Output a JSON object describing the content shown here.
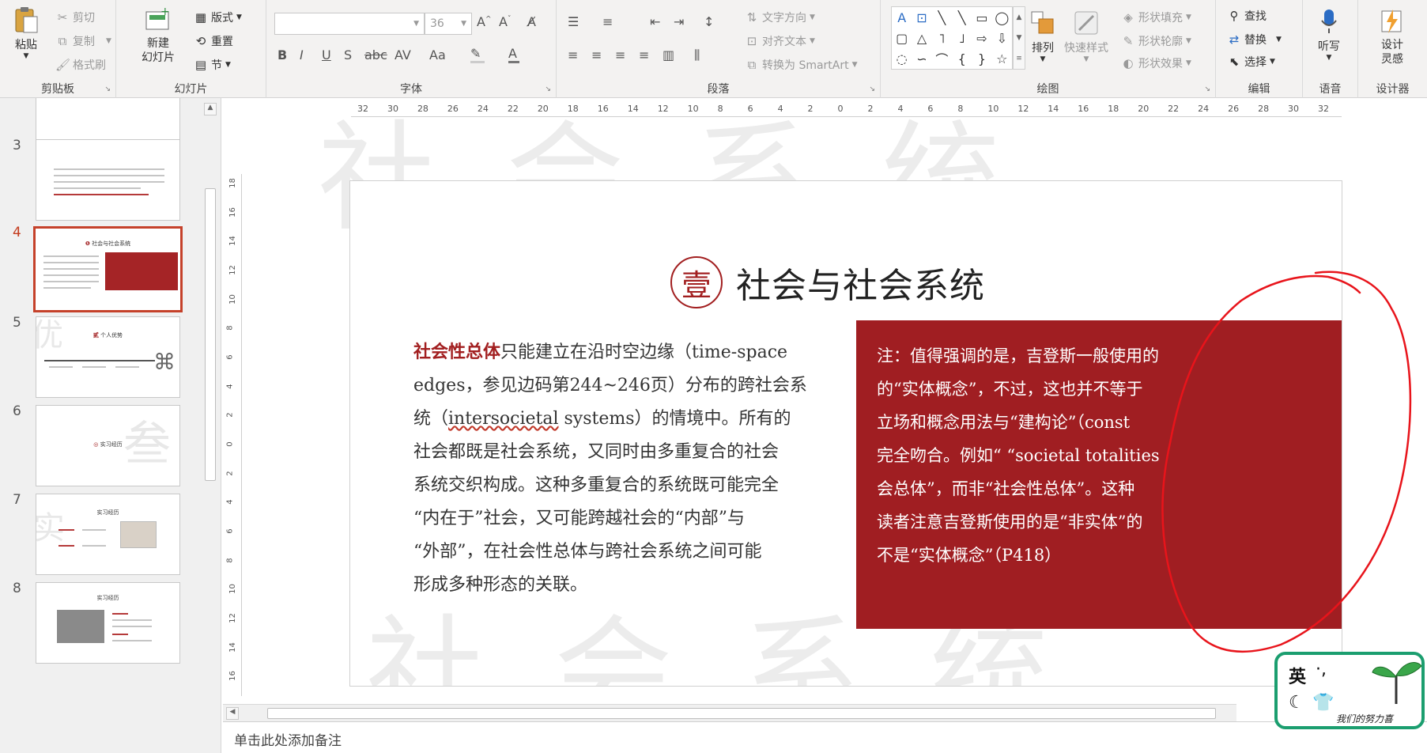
{
  "ribbon": {
    "clipboard": {
      "label": "剪贴板",
      "paste": "粘贴",
      "cut": "剪切",
      "copy": "复制",
      "format_painter": "格式刷"
    },
    "slides": {
      "label": "幻灯片",
      "new_slide": "新建\n幻灯片",
      "layout": "版式",
      "reset": "重置",
      "section": "节"
    },
    "font": {
      "label": "字体",
      "font_name": "",
      "font_size": "36",
      "bold": "B",
      "italic": "I",
      "underline": "U",
      "shadow": "S",
      "strike": "abc",
      "spacing": "AV",
      "case": "Aa"
    },
    "paragraph": {
      "label": "段落",
      "text_direction": "文字方向",
      "align_text": "对齐文本",
      "smartart": "转换为 SmartArt"
    },
    "drawing": {
      "label": "绘图",
      "arrange": "排列",
      "quick_styles": "快速样式",
      "shape_fill": "形状填充",
      "shape_outline": "形状轮廓",
      "shape_effects": "形状效果"
    },
    "editing": {
      "label": "编辑",
      "find": "查找",
      "replace": "替换",
      "select": "选择"
    },
    "voice": {
      "label": "语音",
      "dictate": "听写"
    },
    "designer": {
      "label": "设计器",
      "design_ideas": "设计\n灵感"
    }
  },
  "thumbnails": {
    "items": [
      {
        "num": "3"
      },
      {
        "num": "4"
      },
      {
        "num": "5"
      },
      {
        "num": "6"
      },
      {
        "num": "7"
      },
      {
        "num": "8"
      }
    ],
    "slide4_title": "社会与社会系统",
    "slide5_title": "个人优势",
    "slide5_badge": "贰",
    "slide6_title": "实习经历",
    "slide7_title": "实习经历",
    "slide8_title": "实习经历"
  },
  "slide": {
    "seal": "壹",
    "title": "社会与社会系统",
    "body": {
      "highlight": "社会性总体",
      "lines": [
        "只能建立在沿时空边缘（time-space",
        "edges，参见边码第244~246页）分布的跨社会系",
        "统（",
        "intersocietal",
        " systems）的情境中。所有的",
        "社会都既是社会系统，又同时由多重复合的社会",
        "系统交织构成。这种多重复合的系统既可能完全",
        "“内在于”社会，又可能跨越社会的“内部”与",
        "“外部”，在社会性总体与跨社会系统之间可能",
        "形成多种形态的关联。"
      ]
    },
    "note": {
      "lines": [
        "注：值得强调的是，吉登斯一般使用的",
        "的“实体概念”，不过，这也并不等于",
        "立场和概念用法与“建构论”（const",
        "完全吻合。例如“ “societal totalities",
        "会总体”，而非“社会性总体”。这种",
        "读者注意吉登斯使用的是“非实体”的",
        "不是“实体概念”（P418）"
      ]
    },
    "watermark_top": "社 会 系 统",
    "watermark_bottom": "社 会 系 统"
  },
  "rulers": {
    "h_labels": [
      "32",
      "30",
      "28",
      "26",
      "24",
      "22",
      "20",
      "18",
      "16",
      "14",
      "12",
      "10",
      "8",
      "6",
      "4",
      "2",
      "0",
      "2",
      "4",
      "6",
      "8",
      "10",
      "12",
      "14",
      "16",
      "18",
      "20",
      "22",
      "24",
      "26",
      "28",
      "30",
      "32"
    ],
    "v_labels": [
      "18",
      "16",
      "14",
      "12",
      "10",
      "8",
      "6",
      "4",
      "2",
      "0",
      "2",
      "4",
      "6",
      "8",
      "10",
      "12",
      "14",
      "16"
    ]
  },
  "notes": {
    "placeholder": "单击此处添加备注"
  },
  "ime": {
    "lang": "英",
    "punct": "·,",
    "slogan": "我们的努力喜"
  },
  "colors": {
    "accent_red": "#a21f20",
    "note_box": "#a01e22",
    "annotation": "#e8141b",
    "ime_border": "#1b9e6f"
  }
}
